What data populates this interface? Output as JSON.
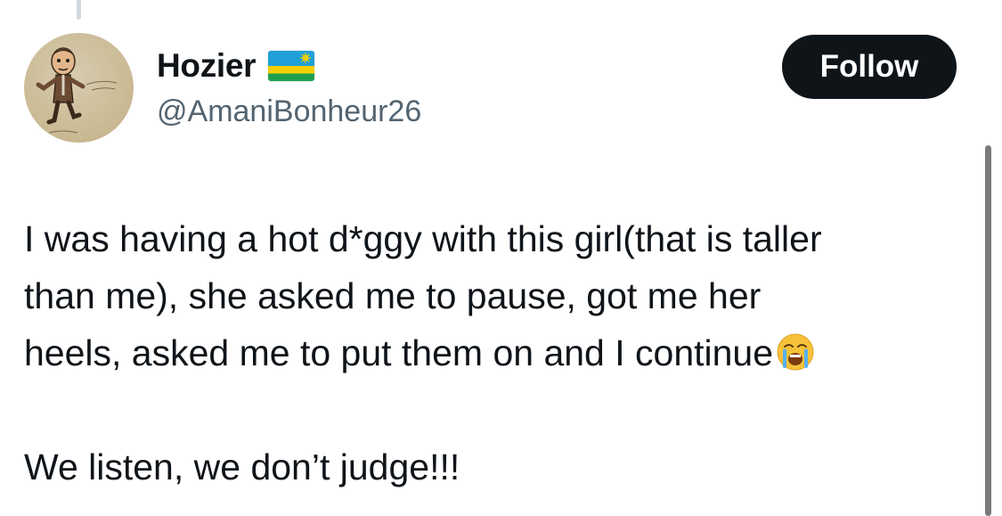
{
  "user": {
    "display_name": "Hozier",
    "handle": "@AmaniBonheur26",
    "flag_icon": "rwanda-flag-icon",
    "avatar_icon": "cartoon-character-avatar"
  },
  "follow_label": "Follow",
  "tweet": {
    "line1": "I was having a hot d*ggy with this girl(that is taller",
    "line2": "than me), she asked me to pause, got me her",
    "line3": "heels, asked me to put them on and I continue",
    "emoji": "loudly-crying-face-icon",
    "line4": "We listen, we don’t judge!!!"
  },
  "colors": {
    "text": "#0f1419",
    "secondary": "#536471",
    "button_bg": "#0f1419",
    "button_text": "#ffffff"
  }
}
